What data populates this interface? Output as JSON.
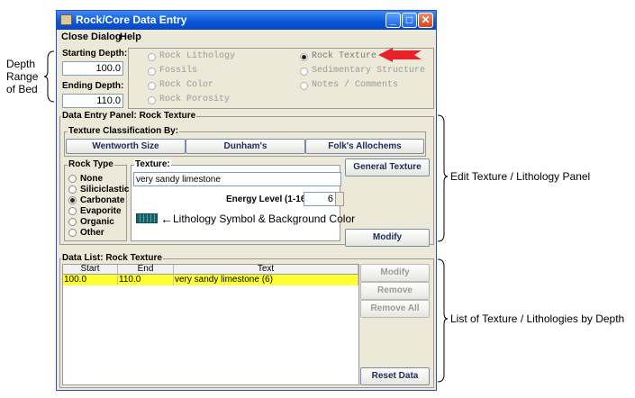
{
  "window": {
    "title": "Rock/Core Data Entry",
    "controls": [
      "_",
      "□",
      "✕"
    ]
  },
  "menu": [
    "Close Dialog",
    "Help"
  ],
  "depth": {
    "starting_label": "Starting Depth:",
    "starting_value": "100.0",
    "ending_label": "Ending Depth:",
    "ending_value": "110.0"
  },
  "data_type_options": [
    {
      "label": "Rock Lithology",
      "selected": false
    },
    {
      "label": "Fossils",
      "selected": false
    },
    {
      "label": "Rock Color",
      "selected": false
    },
    {
      "label": "Rock Porosity",
      "selected": false
    },
    {
      "label": "Rock Texture",
      "selected": true
    },
    {
      "label": "Sedimentary Structure",
      "selected": false
    },
    {
      "label": "Notes / Comments",
      "selected": false
    }
  ],
  "panel": {
    "title": "Data Entry Panel: Rock Texture",
    "classification_title": "Texture Classification By:",
    "classification_buttons": [
      "Wentworth Size",
      "Dunham's",
      "Folk's Allochems"
    ],
    "rock_type_title": "Rock Type",
    "rock_types": [
      {
        "label": "None",
        "selected": false
      },
      {
        "label": "Siliciclastic",
        "selected": false
      },
      {
        "label": "Carbonate",
        "selected": true
      },
      {
        "label": "Evaporite",
        "selected": false
      },
      {
        "label": "Organic",
        "selected": false
      },
      {
        "label": "Other",
        "selected": false
      }
    ],
    "texture_title": "Texture:",
    "texture_value": "very sandy limestone",
    "energy_label": "Energy Level (1-16):",
    "energy_value": "6",
    "general_texture_button": "General Texture",
    "modify_button": "Modify",
    "symbol_note": "Lithology Symbol & Background Color"
  },
  "data_list": {
    "title": "Data List: Rock Texture",
    "columns": [
      "Start",
      "End",
      "Text"
    ],
    "rows": [
      {
        "start": "100.0",
        "end": "110.0",
        "text": "very sandy limestone  (6)"
      }
    ],
    "buttons": {
      "modify": "Modify",
      "remove": "Remove",
      "remove_all": "Remove All",
      "reset": "Reset Data"
    }
  },
  "annotations": {
    "depth": [
      "Depth",
      "Range",
      "of Bed"
    ],
    "edit_panel": "Edit Texture / Lithology Panel",
    "list_panel": "List of Texture / Lithologies by Depth"
  },
  "colors": {
    "selection_row": "#ffff33",
    "callout_arrow": "#e8202a",
    "titlebar": "#0a55d8"
  }
}
